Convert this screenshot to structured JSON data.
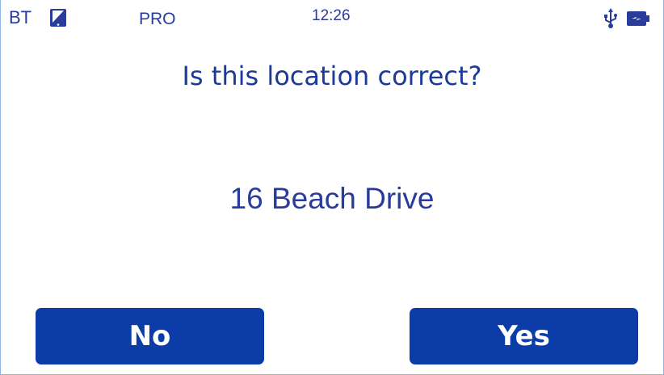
{
  "status_bar": {
    "bt_label": "BT",
    "mode_label": "PRO",
    "time": "12:26",
    "icons": [
      "tablet-icon",
      "usb-icon",
      "battery-charging-icon"
    ]
  },
  "dialog": {
    "question": "Is this location correct?",
    "location": "16 Beach Drive"
  },
  "buttons": {
    "no_label": "No",
    "yes_label": "Yes"
  },
  "colors": {
    "accent": "#0b3ca7",
    "text": "#1b3a9a",
    "button_text": "#ffffff"
  }
}
